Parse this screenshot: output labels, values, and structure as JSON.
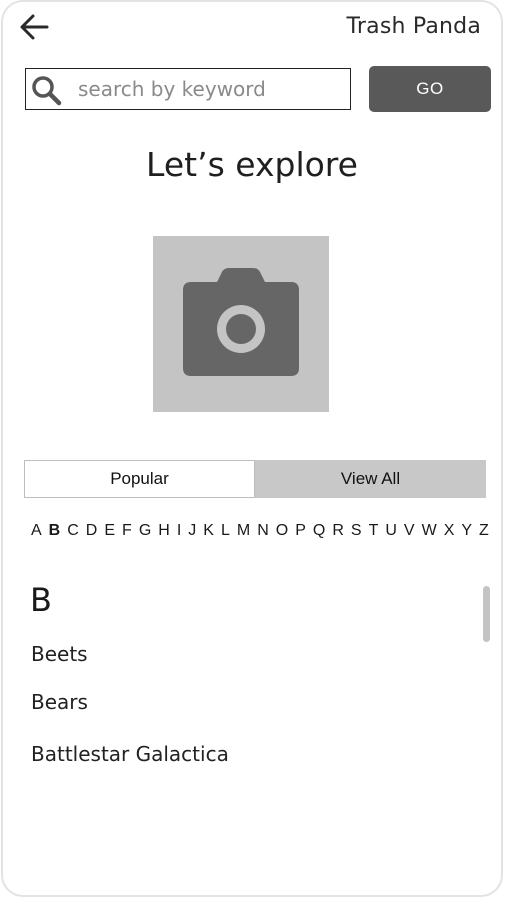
{
  "header": {
    "back_icon": "arrow-left-icon",
    "app_title": "Trash Panda"
  },
  "search": {
    "icon": "search-icon",
    "placeholder": "search by keyword",
    "value": "",
    "go_label": "GO"
  },
  "main": {
    "title": "Let’s explore",
    "image_icon": "camera-icon"
  },
  "tabs": [
    {
      "label": "Popular",
      "selected": false
    },
    {
      "label": "View All",
      "selected": true
    }
  ],
  "alphabet": {
    "letters": [
      "A",
      "B",
      "C",
      "D",
      "E",
      "F",
      "G",
      "H",
      "I",
      "J",
      "K",
      "L",
      "M",
      "N",
      "O",
      "P",
      "Q",
      "R",
      "S",
      "T",
      "U",
      "V",
      "W",
      "X",
      "Y",
      "Z"
    ],
    "active": "B"
  },
  "results": {
    "section_letter": "B",
    "items": [
      "Beets",
      "Bears",
      "Battlestar Galactica"
    ]
  },
  "colors": {
    "go_button": "#595959",
    "placeholder_bg": "#c4c4c4",
    "camera": "#666666",
    "active_tab": "#c8c8c8"
  }
}
